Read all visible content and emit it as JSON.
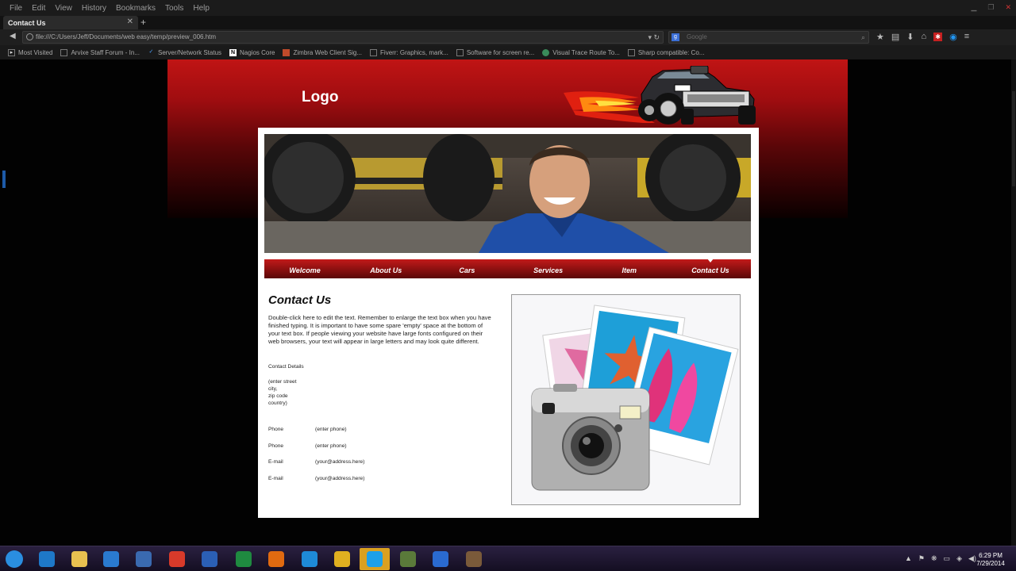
{
  "browser": {
    "menu": [
      "File",
      "Edit",
      "View",
      "History",
      "Bookmarks",
      "Tools",
      "Help"
    ],
    "tab_title": "Contact Us",
    "url": "file:///C:/Users/Jeff/Documents/web easy/temp/preview_006.htm",
    "search_placeholder": "Google",
    "bookmarks": [
      {
        "label": "Most Visited",
        "icon": "bookmark-icon"
      },
      {
        "label": "Arvixe Staff Forum - In...",
        "icon": "page-icon"
      },
      {
        "label": "Server/Network Status",
        "icon": "checkmark-icon"
      },
      {
        "label": "Nagios Core",
        "icon": "nagios-n-icon"
      },
      {
        "label": "Zimbra Web Client Sig...",
        "icon": "zimbra-icon"
      },
      {
        "label": "Fiverr: Graphics, mark...",
        "icon": "page-icon"
      },
      {
        "label": "Software for screen re...",
        "icon": "page-icon"
      },
      {
        "label": "Visual Trace Route To...",
        "icon": "globe-icon"
      },
      {
        "label": "Sharp compatible: Co...",
        "icon": "page-icon"
      }
    ]
  },
  "site": {
    "logo": "Logo",
    "nav": [
      "Welcome",
      "About Us",
      "Cars",
      "Services",
      "Item",
      "Contact Us"
    ],
    "nav_active": "Contact Us",
    "title": "Contact Us",
    "body": "Double-click here to edit the text. Remember to enlarge the text box when you have finished typing. It is important to have some spare 'empty' space at the bottom of your text box. If people viewing your website have large fonts configured on their web browsers, your text will appear in large letters and may look quite different.",
    "contact_details_label": "Contact Details",
    "address": [
      "(enter street",
      "city,",
      "zip code",
      "country)"
    ],
    "rows": [
      {
        "label": "Phone",
        "value": "(enter phone)"
      },
      {
        "label": "Phone",
        "value": "(enter phone)"
      },
      {
        "label": "E-mail",
        "value": "(your@address.here)"
      },
      {
        "label": "E-mail",
        "value": "(your@address.here)"
      }
    ]
  },
  "taskbar": {
    "time": "6:29 PM",
    "date": "7/29/2014",
    "apps": [
      "start-orb-icon",
      "ie-pinned-icon",
      "folder-icon",
      "wifi-icon",
      "media-player-icon",
      "chat-icon",
      "word-icon",
      "excel-icon",
      "firefox-icon",
      "internet-explorer-icon",
      "chrome-icon",
      "skype-icon",
      "app-icon",
      "network-globe-icon",
      "tool-icon"
    ]
  },
  "colors": {
    "brand_red": "#c01414",
    "nav_dark": "#5a0707",
    "taskbar": "#1e1530"
  }
}
